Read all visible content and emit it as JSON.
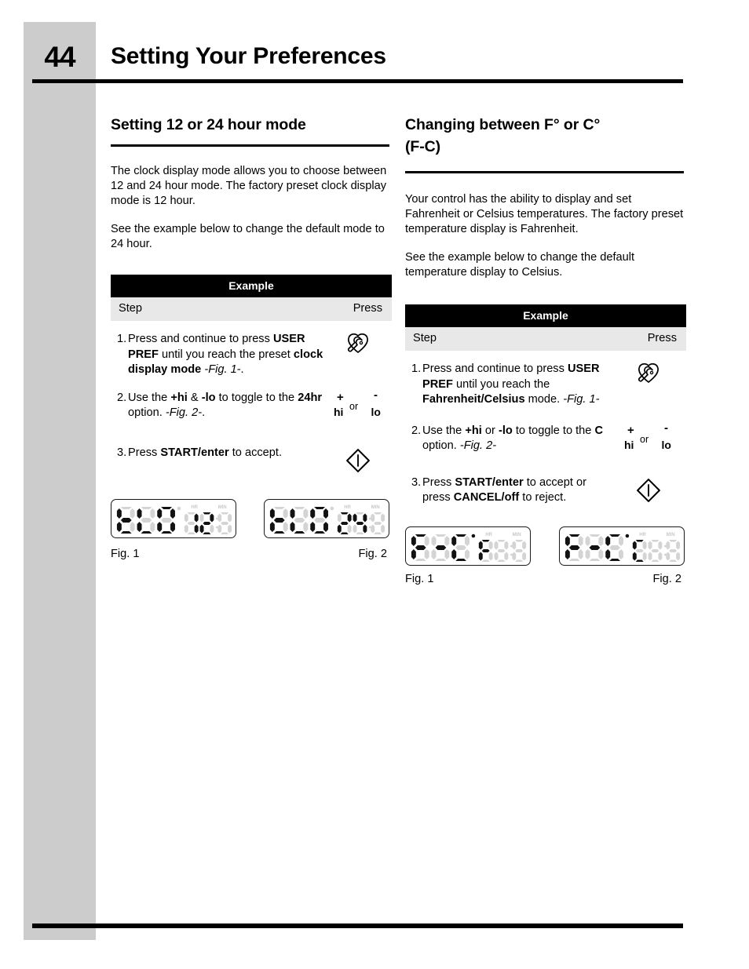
{
  "page": {
    "number": "44",
    "title": "Setting Your Preferences"
  },
  "colors": {
    "sidebar_gray": "#cccccc",
    "table_header_black": "#000000",
    "table_subhead_gray": "#e8e8e8",
    "lcd_segment_on": "#121212",
    "lcd_segment_off": "#d4d4d4"
  },
  "left_column": {
    "heading": "Setting 12 or 24 hour mode",
    "paragraph_1": "The clock display mode allows you to choose between 12 and 24 hour mode. The factory preset clock display mode is 12 hour.",
    "paragraph_2": "See the example below to change the default mode to 24 hour.",
    "table": {
      "title": "Example",
      "col_step": "Step",
      "col_press": "Press"
    },
    "steps": [
      {
        "number": "1.",
        "text_parts": [
          {
            "t": "Press and continue to press ",
            "style": "normal"
          },
          {
            "t": "USER PREF",
            "style": "bold"
          },
          {
            "t": " until you reach the preset ",
            "style": "normal"
          },
          {
            "t": "clock display mode",
            "style": "bold"
          },
          {
            "t": " ",
            "style": "normal"
          },
          {
            "t": "-Fig. 1-",
            "style": "italic"
          },
          {
            "t": ".",
            "style": "normal"
          }
        ],
        "press_icon": "user-pref-wrench-icon"
      },
      {
        "number": "2.",
        "text_parts": [
          {
            "t": "Use the ",
            "style": "normal"
          },
          {
            "t": "+hi",
            "style": "bold"
          },
          {
            "t": " & ",
            "style": "normal"
          },
          {
            "t": "-lo",
            "style": "bold"
          },
          {
            "t": " to toggle to the ",
            "style": "normal"
          },
          {
            "t": "24hr",
            "style": "bold"
          },
          {
            "t": " option. ",
            "style": "normal"
          },
          {
            "t": "-Fig. 2-",
            "style": "italic"
          },
          {
            "t": ".",
            "style": "normal"
          }
        ],
        "press_icon": "hi-lo-icon"
      },
      {
        "number": "3.",
        "text_parts": [
          {
            "t": "Press ",
            "style": "normal"
          },
          {
            "t": "START/enter",
            "style": "bold"
          },
          {
            "t": " to accept.",
            "style": "normal"
          }
        ],
        "press_icon": "start-enter-diamond-icon"
      }
    ],
    "hilo_icon": {
      "plus": "+",
      "minus": "-",
      "hi": "hi",
      "or": "or",
      "lo": "lo"
    },
    "figures": [
      {
        "caption": "Fig. 1",
        "lcd_left_text": "CLO",
        "lcd_right_text": "12",
        "lcd_label_hr": "HR",
        "lcd_label_min": "MIN"
      },
      {
        "caption": "Fig. 2",
        "lcd_left_text": "CLO",
        "lcd_right_text": "24",
        "lcd_label_hr": "HR",
        "lcd_label_min": "MIN"
      }
    ]
  },
  "right_column": {
    "heading_line_1": "Changing between F° or C°",
    "heading_line_2": "(F-C)",
    "paragraph_1": "Your control has the ability to display and set Fahrenheit or Celsius temperatures. The factory preset temperature display is Fahrenheit.",
    "paragraph_2": "See the example below to change the default temperature display to Celsius.",
    "table": {
      "title": "Example",
      "col_step": "Step",
      "col_press": "Press"
    },
    "steps": [
      {
        "number": "1.",
        "text_parts": [
          {
            "t": "Press and continue to press ",
            "style": "normal"
          },
          {
            "t": "USER PREF",
            "style": "bold"
          },
          {
            "t": " until you reach the ",
            "style": "normal"
          },
          {
            "t": "Fahrenheit/Celsius",
            "style": "bold"
          },
          {
            "t": " mode. ",
            "style": "normal"
          },
          {
            "t": "-Fig. 1-",
            "style": "italic"
          }
        ],
        "press_icon": "user-pref-wrench-icon"
      },
      {
        "number": "2.",
        "text_parts": [
          {
            "t": "Use the ",
            "style": "normal"
          },
          {
            "t": "+hi",
            "style": "bold"
          },
          {
            "t": " or ",
            "style": "normal"
          },
          {
            "t": "-lo",
            "style": "bold"
          },
          {
            "t": " to toggle to the ",
            "style": "normal"
          },
          {
            "t": "C",
            "style": "bold"
          },
          {
            "t": " option. ",
            "style": "normal"
          },
          {
            "t": "-Fig. 2-",
            "style": "italic"
          }
        ],
        "press_icon": "hi-lo-icon"
      },
      {
        "number": "3.",
        "text_parts": [
          {
            "t": "Press ",
            "style": "normal"
          },
          {
            "t": "START/enter",
            "style": "bold"
          },
          {
            "t": " to accept or press ",
            "style": "normal"
          },
          {
            "t": "CANCEL/off",
            "style": "bold"
          },
          {
            "t": " to reject.",
            "style": "normal"
          }
        ],
        "press_icon": "start-enter-diamond-icon"
      }
    ],
    "hilo_icon": {
      "plus": "+",
      "minus": "-",
      "hi": "hi",
      "or": "or",
      "lo": "lo"
    },
    "figures": [
      {
        "caption": "Fig. 1",
        "lcd_left_text": "F-C",
        "lcd_right_text": "F",
        "lcd_label_hr": "HR",
        "lcd_label_min": "MIN"
      },
      {
        "caption": "Fig. 2",
        "lcd_left_text": "F-C",
        "lcd_right_text": "C",
        "lcd_label_hr": "HR",
        "lcd_label_min": "MIN"
      }
    ]
  }
}
